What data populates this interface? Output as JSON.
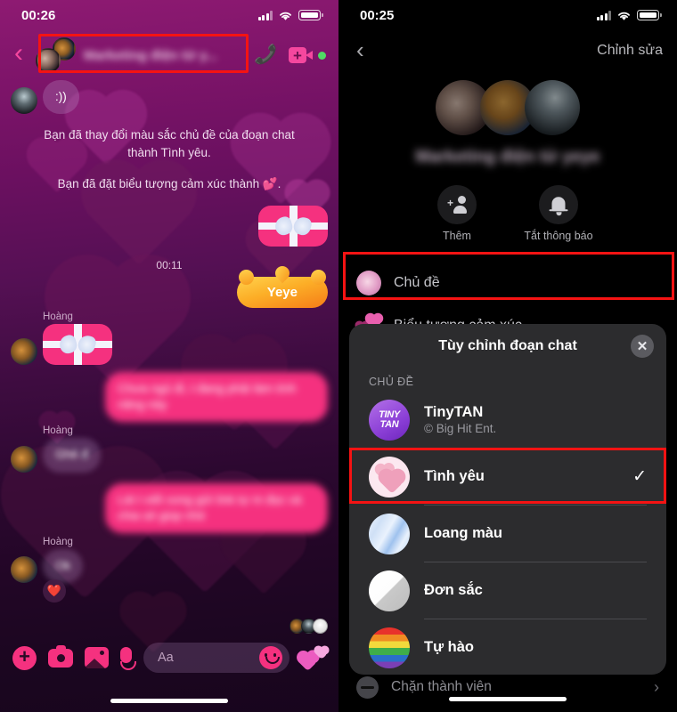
{
  "left_phone": {
    "status_bar": {
      "time": "00:26",
      "signal_icon": "cellular-bars-icon",
      "wifi_icon": "wifi-icon",
      "battery_icon": "battery-icon"
    },
    "header": {
      "back_icon": "chevron-left-icon",
      "title": "Marketing điện tử y...",
      "call_icon": "phone-icon",
      "video_icon": "video-call-icon",
      "online_indicator": "online-dot"
    },
    "messages": [
      {
        "type": "bubble",
        "side": "them",
        "text": ":))"
      },
      {
        "type": "system",
        "text": "Bạn đã thay đổi màu sắc chủ đề của đoạn chat thành Tình yêu."
      },
      {
        "type": "system",
        "text": "Bạn đã đặt biểu tượng cảm xúc thành 💕."
      },
      {
        "type": "sticker",
        "side": "me",
        "sticker": "gift-box-sticker"
      },
      {
        "type": "timestamp",
        "text": "00:11"
      },
      {
        "type": "sticker",
        "side": "me",
        "sticker": "crown-sticker",
        "text": "Yeye"
      },
      {
        "type": "sticker",
        "side": "them",
        "sender": "Hoàng",
        "sticker": "gift-box-sticker"
      },
      {
        "type": "bubble",
        "side": "me",
        "text": "Chưa ngủ đi, t đang phải làm tính năng này",
        "blurred": true
      },
      {
        "type": "bubble",
        "side": "them",
        "sender": "Hoàng",
        "text": "Ghê đ",
        "blurred": true
      },
      {
        "type": "bubble",
        "side": "me",
        "text": "Lát t viết xong gửi link tự m đọc và chia sẻ giúp nhé",
        "blurred": true
      },
      {
        "type": "bubble",
        "side": "them",
        "sender": "Hoàng",
        "text": "Ok",
        "blurred": true,
        "reaction": "❤️"
      }
    ],
    "seen_avatars": [
      "seen-avatar-1",
      "seen-avatar-2",
      "seen-avatar-3"
    ],
    "composer": {
      "plus_icon": "plus-circle-icon",
      "camera_icon": "camera-icon",
      "gallery_icon": "gallery-icon",
      "mic_icon": "microphone-icon",
      "input_placeholder": "Aa",
      "input_value": "",
      "sticker_icon": "smiley-icon",
      "quick_reaction_icon": "hearts-icon"
    },
    "home_indicator": "home-indicator"
  },
  "right_phone": {
    "status_bar": {
      "time": "00:25",
      "signal_icon": "cellular-bars-icon",
      "wifi_icon": "wifi-icon",
      "battery_icon": "battery-icon"
    },
    "nav": {
      "back_icon": "chevron-left-icon",
      "edit_label": "Chỉnh sửa"
    },
    "group": {
      "title": "Marketing điện tử yeye",
      "avatars": [
        "group-avatar-1",
        "group-avatar-2",
        "group-avatar-3"
      ]
    },
    "quick_actions": [
      {
        "icon": "add-person-icon",
        "label": "Thêm"
      },
      {
        "icon": "bell-icon",
        "label": "Tắt thông báo"
      }
    ],
    "settings_rows": [
      {
        "icon": "theme-swatch-love",
        "label": "Chủ đề",
        "highlighted": true
      },
      {
        "icon": "emoji-hearts-icon",
        "label": "Biểu tượng cảm xúc",
        "highlighted": false
      }
    ],
    "block_row": {
      "icon": "block-icon",
      "label": "Chặn thành viên",
      "chevron_icon": "chevron-right-icon"
    },
    "sheet": {
      "title": "Tùy chỉnh đoạn chat",
      "close_icon": "close-icon",
      "section_label": "CHỦ ĐỀ",
      "themes": [
        {
          "name": "TinyTAN",
          "subtitle": "© Big Hit Ent.",
          "icon": "tinytan-icon",
          "selected": false,
          "highlighted": false
        },
        {
          "name": "Tình yêu",
          "subtitle": "",
          "icon": "love-hearts-icon",
          "selected": true,
          "highlighted": true,
          "check_icon": "check-icon"
        },
        {
          "name": "Loang màu",
          "subtitle": "",
          "icon": "tie-dye-icon",
          "selected": false,
          "highlighted": false
        },
        {
          "name": "Đơn sắc",
          "subtitle": "",
          "icon": "monochrome-icon",
          "selected": false,
          "highlighted": false
        },
        {
          "name": "Tự hào",
          "subtitle": "",
          "icon": "pride-rainbow-icon",
          "selected": false,
          "highlighted": false
        }
      ]
    },
    "home_indicator": "home-indicator"
  },
  "colors": {
    "accent_pink": "#f5317f",
    "highlight_red": "#f51313",
    "sheet_bg": "#2c2c2e",
    "dark_bg": "#000000"
  }
}
